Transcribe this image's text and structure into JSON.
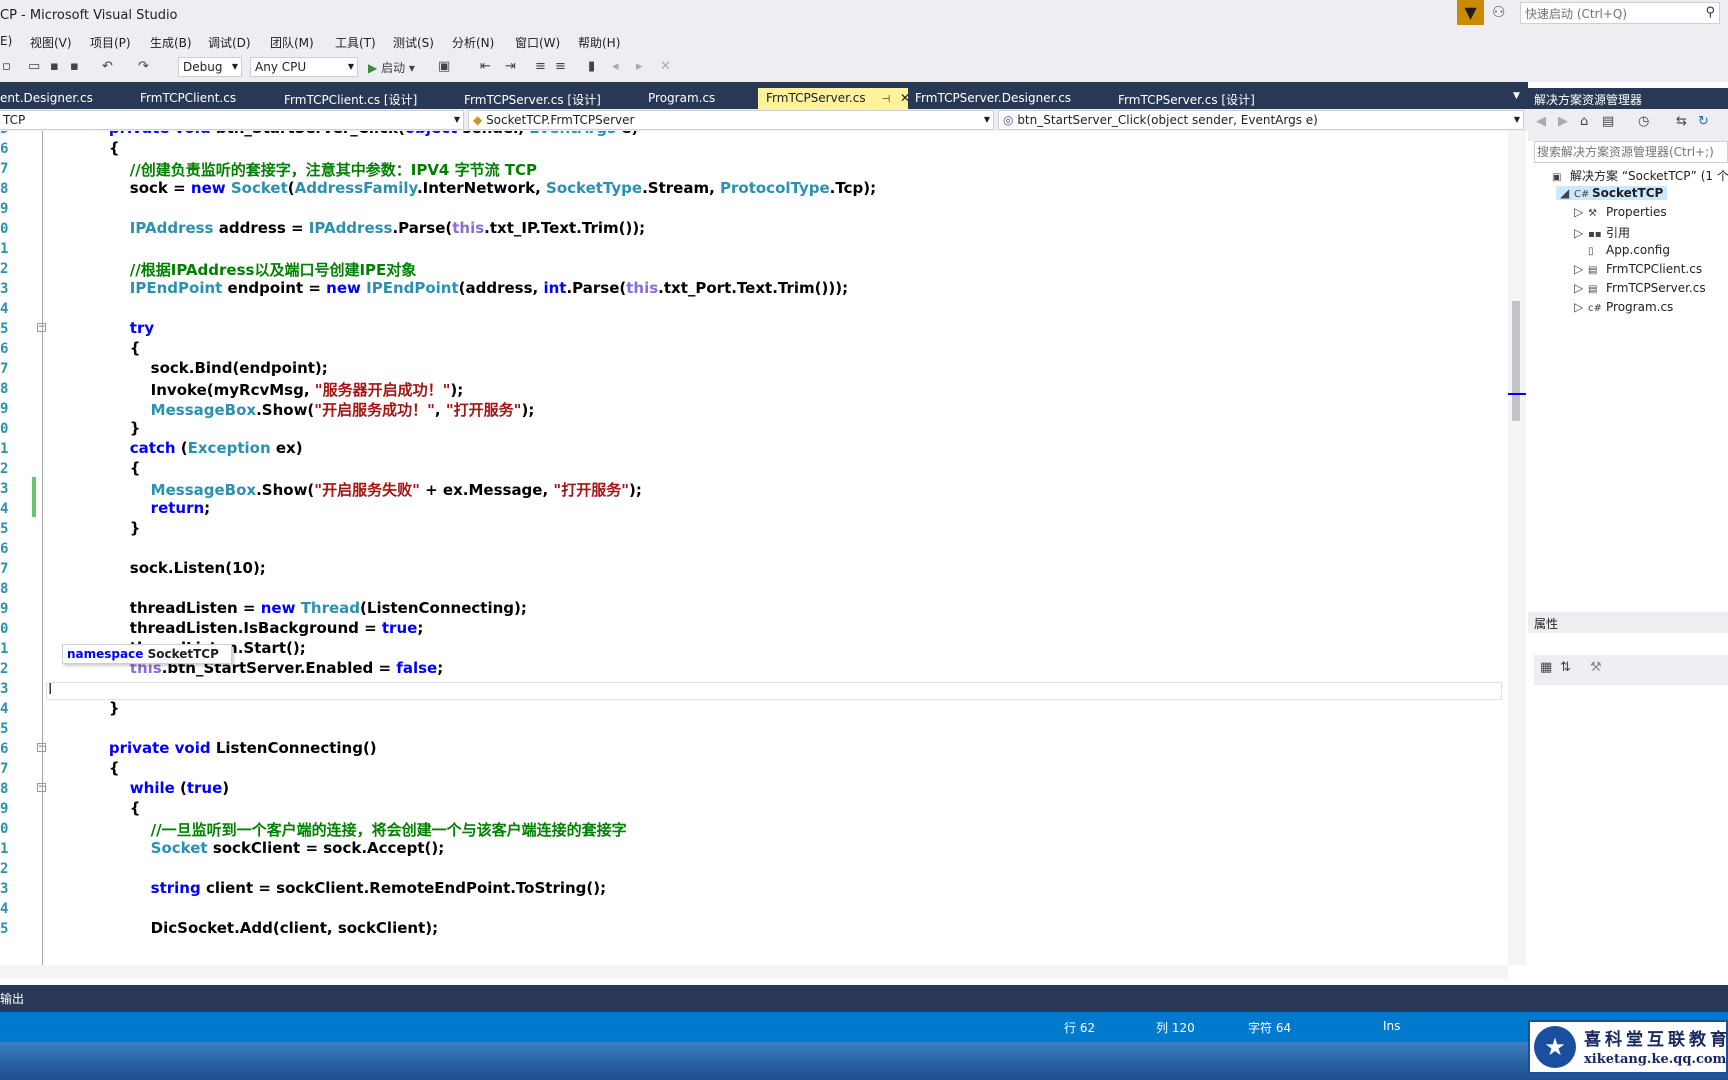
{
  "window": {
    "title": "CP - Microsoft Visual Studio"
  },
  "quick_launch": {
    "placeholder": "快速启动 (Ctrl+Q)"
  },
  "menu": [
    "E)",
    "视图(V)",
    "项目(P)",
    "生成(B)",
    "调试(D)",
    "团队(M)",
    "工具(T)",
    "测试(S)",
    "分析(N)",
    "窗口(W)",
    "帮助(H)"
  ],
  "toolbar": {
    "config": "Debug",
    "platform": "Any CPU",
    "start": "启动"
  },
  "tabs": [
    {
      "label": "ent.Designer.cs",
      "active": false
    },
    {
      "label": "FrmTCPClient.cs",
      "active": false
    },
    {
      "label": "FrmTCPClient.cs [设计]",
      "active": false
    },
    {
      "label": "FrmTCPServer.cs [设计]",
      "active": false
    },
    {
      "label": "Program.cs",
      "active": false
    },
    {
      "label": "FrmTCPServer.cs",
      "active": true
    },
    {
      "label": "FrmTCPServer.Designer.cs",
      "active": false
    },
    {
      "label": "FrmTCPServer.cs [设计]",
      "active": false
    }
  ],
  "nav": {
    "project": "TCP",
    "class": "SocketTCP.FrmTCPServer",
    "member": "btn_StartServer_Click(object sender, EventArgs e)"
  },
  "line_numbers": [
    "5",
    "6",
    "7",
    "8",
    "9",
    "0",
    "1",
    "2",
    "3",
    "4",
    "5",
    "6",
    "7",
    "8",
    "9",
    "0",
    "1",
    "2",
    "3",
    "4",
    "5",
    "6",
    "7",
    "8",
    "9",
    "0",
    "1",
    "2",
    "3",
    "4",
    "5",
    "6",
    "7",
    "8",
    "9",
    "0",
    "1",
    "2",
    "3",
    "4",
    "5"
  ],
  "tooltip": {
    "keyword": "namespace",
    "name": "SocketTCP"
  },
  "solution_explorer": {
    "title": "解决方案资源管理器",
    "search_placeholder": "搜索解决方案资源管理器(Ctrl+;)",
    "items": [
      {
        "label": "解决方案 “SocketTCP” (1 个",
        "indent": 0,
        "icon": "solution-icon",
        "bold": false
      },
      {
        "label": "SocketTCP",
        "indent": 1,
        "icon": "csharp-project-icon",
        "bold": true
      },
      {
        "label": "Properties",
        "indent": 2,
        "icon": "wrench-icon",
        "bold": false
      },
      {
        "label": "引用",
        "indent": 2,
        "icon": "references-icon",
        "bold": false
      },
      {
        "label": "App.config",
        "indent": 2,
        "icon": "config-file-icon",
        "bold": false
      },
      {
        "label": "FrmTCPClient.cs",
        "indent": 2,
        "icon": "form-icon",
        "bold": false
      },
      {
        "label": "FrmTCPServer.cs",
        "indent": 2,
        "icon": "form-icon",
        "bold": false
      },
      {
        "label": "Program.cs",
        "indent": 2,
        "icon": "csharp-file-icon",
        "bold": false
      }
    ]
  },
  "properties": {
    "title": "属性"
  },
  "output": {
    "label": "输出"
  },
  "status": {
    "line": "行 62",
    "col": "列 120",
    "char": "字符 64",
    "mode": "Ins"
  },
  "watermark": {
    "cn": "喜科堂互联教育",
    "en": "xiketang.ke.qq.com"
  },
  "colors": {
    "accent": "#007acc",
    "dark": "#293955",
    "active_tab": "#fff29d"
  }
}
